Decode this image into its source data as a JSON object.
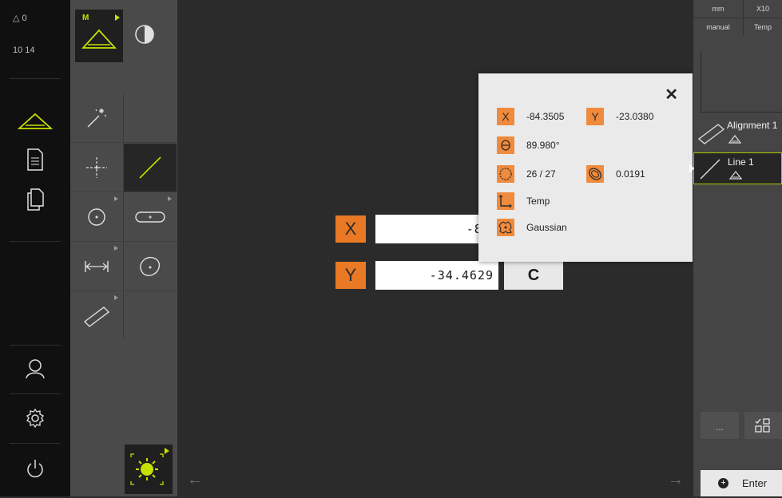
{
  "status": {
    "delta_icon": "delta-icon",
    "delta_value": "0",
    "time": "10 14"
  },
  "nav": [
    {
      "name": "measure-icon"
    },
    {
      "name": "report-icon"
    },
    {
      "name": "files-icon"
    },
    {
      "name": "user-icon"
    },
    {
      "name": "settings-icon"
    },
    {
      "name": "power-icon"
    }
  ],
  "toolbar": {
    "mode_label": "M",
    "tools": [
      "measure-magic-wand",
      "point",
      "line",
      "circle",
      "slot",
      "distance",
      "blob",
      "rectangle"
    ]
  },
  "header": {
    "unit": "mm",
    "zoom": "X10",
    "mode": "manual",
    "temp": "Temp"
  },
  "position": {
    "x_label": "X",
    "x_value": "-84.3581",
    "y_label": "Y",
    "y_value": "-34.4629",
    "clear_label": "C"
  },
  "popup": {
    "x_label": "X",
    "x_value": "-84.3505",
    "y_label": "Y",
    "y_value": "-23.0380",
    "angle": "89.980°",
    "points": "26 / 27",
    "form": "0.0191",
    "temp": "Temp",
    "filter": "Gaussian"
  },
  "features": [
    {
      "label": "Alignment 1"
    },
    {
      "label": "Line 1"
    }
  ],
  "buttons": {
    "more": "...",
    "enter": "Enter"
  },
  "colors": {
    "accent": "#e97924",
    "selected_outline": "#a8c800"
  }
}
